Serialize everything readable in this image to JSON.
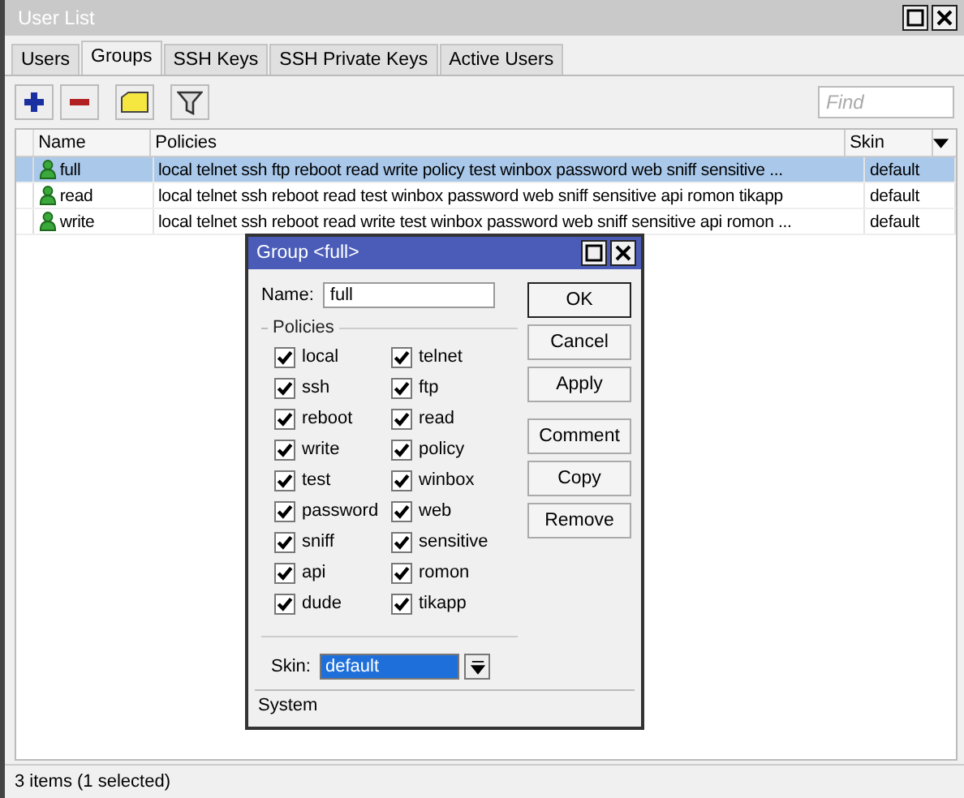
{
  "window": {
    "title": "User List"
  },
  "tabs": [
    {
      "label": "Users",
      "selected": false
    },
    {
      "label": "Groups",
      "selected": true
    },
    {
      "label": "SSH Keys",
      "selected": false
    },
    {
      "label": "SSH Private Keys",
      "selected": false
    },
    {
      "label": "Active Users",
      "selected": false
    }
  ],
  "search": {
    "placeholder": "Find"
  },
  "table": {
    "columns": [
      "Name",
      "Policies",
      "Skin"
    ],
    "rows": [
      {
        "name": "full",
        "policies": "local telnet ssh ftp reboot read write policy test winbox password web sniff sensitive ...",
        "skin": "default",
        "selected": true
      },
      {
        "name": "read",
        "policies": "local telnet ssh reboot read test winbox password web sniff sensitive api romon tikapp",
        "skin": "default",
        "selected": false
      },
      {
        "name": "write",
        "policies": "local telnet ssh reboot read write test winbox password web sniff sensitive api romon ...",
        "skin": "default",
        "selected": false
      }
    ]
  },
  "status_bar": "3 items (1 selected)",
  "dialog": {
    "title": "Group <full>",
    "name_label": "Name:",
    "name_value": "full",
    "policies_label": "Policies",
    "policies": [
      {
        "label": "local",
        "checked": true
      },
      {
        "label": "telnet",
        "checked": true
      },
      {
        "label": "ssh",
        "checked": true
      },
      {
        "label": "ftp",
        "checked": true
      },
      {
        "label": "reboot",
        "checked": true
      },
      {
        "label": "read",
        "checked": true
      },
      {
        "label": "write",
        "checked": true
      },
      {
        "label": "policy",
        "checked": true
      },
      {
        "label": "test",
        "checked": true
      },
      {
        "label": "winbox",
        "checked": true
      },
      {
        "label": "password",
        "checked": true
      },
      {
        "label": "web",
        "checked": true
      },
      {
        "label": "sniff",
        "checked": true
      },
      {
        "label": "sensitive",
        "checked": true
      },
      {
        "label": "api",
        "checked": true
      },
      {
        "label": "romon",
        "checked": true
      },
      {
        "label": "dude",
        "checked": true
      },
      {
        "label": "tikapp",
        "checked": true
      }
    ],
    "skin_label": "Skin:",
    "skin_value": "default",
    "buttons": [
      "OK",
      "Cancel",
      "Apply",
      "Comment",
      "Copy",
      "Remove"
    ],
    "status": "System"
  }
}
